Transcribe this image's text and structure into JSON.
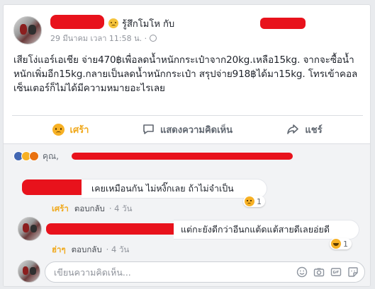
{
  "post": {
    "status_text": "รู้สึกโมโห กับ",
    "timestamp": "29 มีนาคม เวลา 11:58 น. ·",
    "body": "เสียโง่แอร์เอเชีย จ่าย470฿เพื่อลดน้ำหนักกระเป๋าจาก20kg.เหลือ15kg. จากจะซื้อน้ำหนักเพิ่มอีก15kg.กลายเป็นลดน้ำหนักกระเป๋า สรุปจ่าย918฿ได้มา15kg. โทรเข้าคอลเซ็นเตอร์ก็ไม่ได้มีความหมายอะไรเลย"
  },
  "actions": {
    "react_label": "เศร้า",
    "comment_label": "แสดงความคิดเห็น",
    "share_label": "แชร์"
  },
  "reactions": {
    "who_prefix": "คุณ,"
  },
  "comments": [
    {
      "text": "เคยเหมือนกัน ไม่หงิ๊กเลย ถ้าไม่จำเป็น",
      "reaction_count": "1",
      "react_label": "เศร้า",
      "reply_label": "ตอบกลับ",
      "age": "· 4 วัน"
    },
    {
      "text": "แต่กะยังดีกว่าอีนกแต้ดแต้สายดีเลยอ่ยดี",
      "reaction_count": "1",
      "react_label": "ฮ่าๆ",
      "reply_label": "ตอบกลับ",
      "age": "· 4 วัน"
    }
  ],
  "composer": {
    "placeholder": "เขียนความคิดเห็น..."
  },
  "icons": {
    "status_emoji": "angry-face-icon",
    "privacy": "globe-icon",
    "react": "sad-face-icon",
    "comment": "comment-bubble-icon",
    "share": "share-arrow-icon",
    "composer_emoji": "smiley-icon",
    "composer_camera": "camera-icon",
    "composer_gif": "gif-icon",
    "composer_sticker": "sticker-icon"
  },
  "colors": {
    "redaction": "#e8121c",
    "facebook_blue": "#4267b2",
    "sad_yellow": "#f0a91d"
  }
}
